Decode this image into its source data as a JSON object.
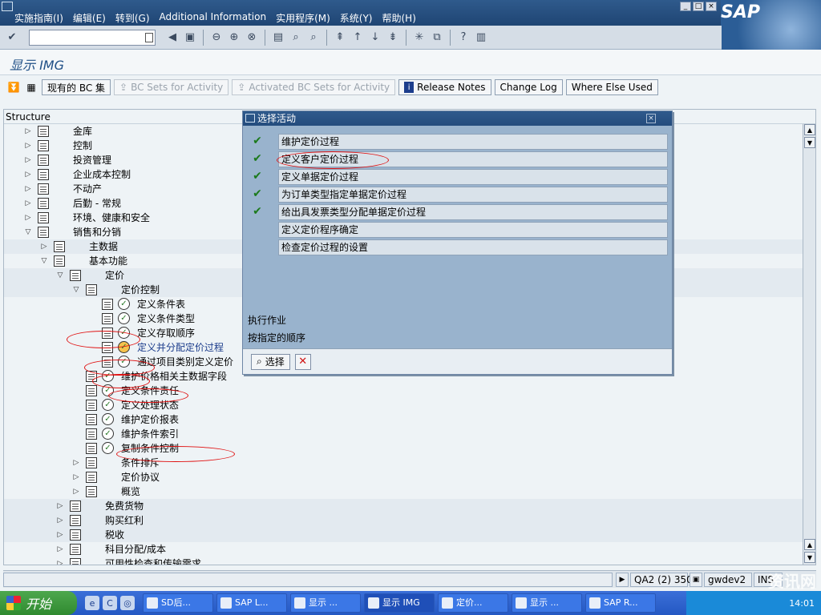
{
  "menubar": {
    "items": [
      "实施指南(I)",
      "编辑(E)",
      "转到(G)",
      "Additional Information",
      "实用程序(M)",
      "系统(Y)",
      "帮助(H)"
    ],
    "logo": "SAP"
  },
  "title": "显示 IMG",
  "app_toolbar": {
    "bc_set": "现有的 BC 集",
    "bc_activity": "BC Sets for Activity",
    "activated_bc": "Activated BC Sets for Activity",
    "release_notes": "Release Notes",
    "change_log": "Change Log",
    "where_else": "Where Else Used"
  },
  "tree": {
    "header": "Structure",
    "rows": [
      {
        "label": "金库"
      },
      {
        "label": "控制"
      },
      {
        "label": "投资管理"
      },
      {
        "label": "企业成本控制"
      },
      {
        "label": "不动产"
      },
      {
        "label": "后勤 - 常规"
      },
      {
        "label": "环境、健康和安全"
      },
      {
        "label": "销售和分销"
      },
      {
        "label": "主数据"
      },
      {
        "label": "基本功能"
      },
      {
        "label": "定价"
      },
      {
        "label": "定价控制"
      },
      {
        "label": "定义条件表"
      },
      {
        "label": "定义条件类型"
      },
      {
        "label": "定义存取顺序"
      },
      {
        "label": "定义并分配定价过程"
      },
      {
        "label": "通过项目类别定义定价"
      },
      {
        "label": "维护价格相关主数据字段"
      },
      {
        "label": "定义条件责任"
      },
      {
        "label": "定义处理状态"
      },
      {
        "label": "维护定价报表"
      },
      {
        "label": "维护条件索引"
      },
      {
        "label": "复制条件控制"
      },
      {
        "label": "条件排斥"
      },
      {
        "label": "定价协议"
      },
      {
        "label": "概览"
      },
      {
        "label": "免费货物"
      },
      {
        "label": "购买红利"
      },
      {
        "label": "税收"
      },
      {
        "label": "科目分配/成本"
      },
      {
        "label": "可用性检查和传输需求"
      }
    ]
  },
  "dialog": {
    "title": "选择活动",
    "activities": [
      {
        "label": "维护定价过程",
        "done": true
      },
      {
        "label": "定义客户定价过程",
        "done": true
      },
      {
        "label": "定义单据定价过程",
        "done": true
      },
      {
        "label": "为订单类型指定单据定价过程",
        "done": true
      },
      {
        "label": "给出具发票类型分配单据定价过程",
        "done": true
      },
      {
        "label": "定义定价程序确定",
        "done": false
      },
      {
        "label": "检查定价过程的设置",
        "done": false
      }
    ],
    "info1": "执行作业",
    "info2": "按指定的顺序",
    "select_btn": "选择"
  },
  "status": {
    "system": "QA2 (2) 350",
    "server": "gwdev2",
    "mode": "INS"
  },
  "taskbar": {
    "start": "开始",
    "tasks": [
      "SD后...",
      "SAP L...",
      "显示 ...",
      "显示 IMG",
      "定价...",
      "显示 ...",
      "SAP R..."
    ],
    "clock": "14:01"
  },
  "watermark": "资讯网"
}
